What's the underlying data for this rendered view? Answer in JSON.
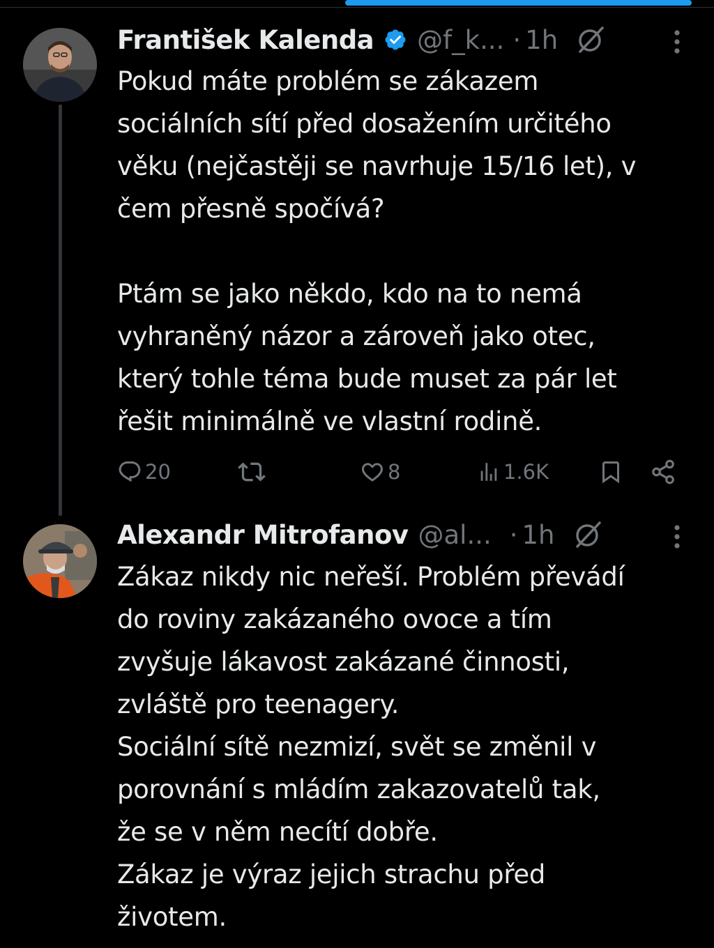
{
  "colors": {
    "background": "#000000",
    "text_primary": "#e7e9ea",
    "text_secondary": "#71767b",
    "accent": "#1d9bf0",
    "thread_line": "#333639"
  },
  "tweets": [
    {
      "author_name": "František Kalenda",
      "verified": true,
      "handle": "@f_k...",
      "separator": "·",
      "time": "1h",
      "text": "Pokud máte problém se zákazem\nsociálních sítí před dosažením určitého\nvěku (nejčastěji se navrhuje 15/16 let), v\nčem přesně spočívá?\n\nPtám se jako někdo, kdo na to nemá\nvyhraněný názor a zároveň jako otec,\nkterý tohle téma bude muset za pár let\nřešit minimálně ve vlastní rodině.",
      "actions": {
        "replies": "20",
        "retweets": "",
        "likes": "8",
        "views": "1.6K"
      },
      "icons": [
        "avatar",
        "verified-badge-icon",
        "grok-icon",
        "more-icon",
        "reply-icon",
        "retweet-icon",
        "like-icon",
        "views-icon",
        "bookmark-icon",
        "share-icon"
      ]
    },
    {
      "author_name": "Alexandr Mitrofanov",
      "verified": false,
      "handle": "@al...",
      "separator": "·",
      "time": "1h",
      "text": "Zákaz nikdy nic neřeší. Problém převádí\ndo roviny zakázaného ovoce a tím\nzvyšuje lákavost zakázané činnosti,\nzvláště pro teenagery.\nSociální sítě nezmizí, svět se změnil v\nporovnání s mládím zakazovatelů tak,\nže se v něm necítí dobře.\nZákaz je výraz jejich strachu před\nživotem.",
      "icons": [
        "avatar",
        "grok-icon",
        "more-icon"
      ]
    }
  ]
}
